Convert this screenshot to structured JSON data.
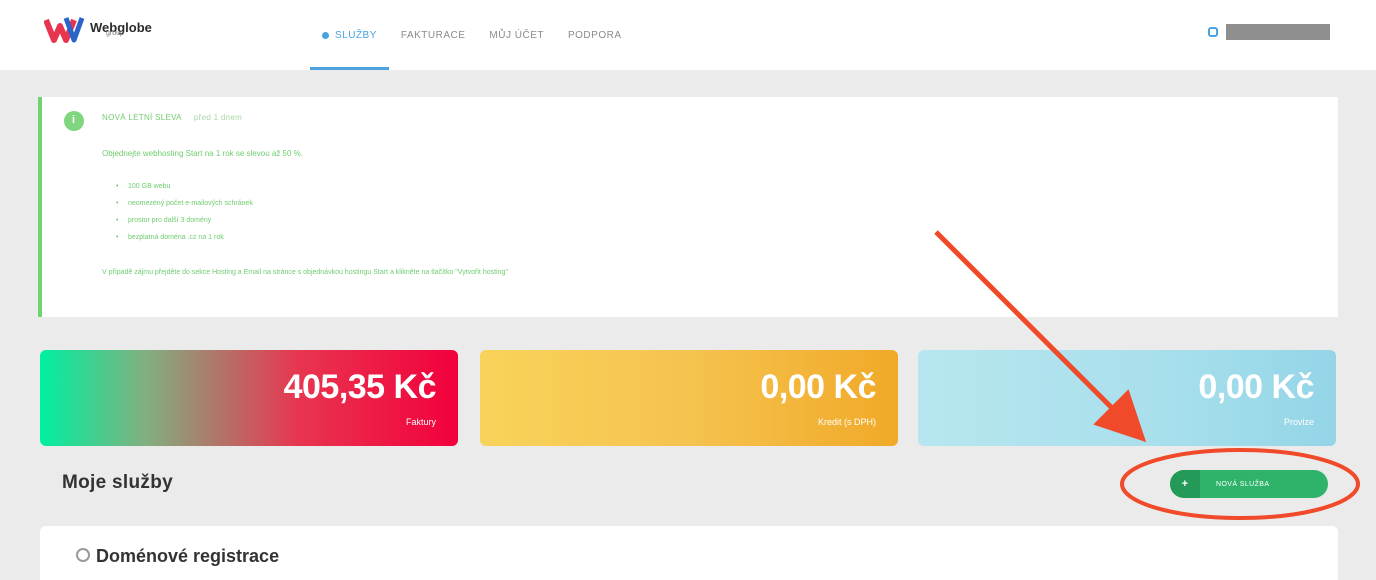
{
  "brand": {
    "name": "Webglobe",
    "sub": "group"
  },
  "nav": {
    "items": [
      {
        "label": "SLUŽBY",
        "active": true
      },
      {
        "label": "FAKTURACE",
        "active": false
      },
      {
        "label": "MŮJ ÚČET",
        "active": false
      },
      {
        "label": "PODPORA",
        "active": false
      }
    ]
  },
  "notice": {
    "title": "NOVÁ LETNÍ SLEVA",
    "date": "před 1 dnem",
    "lead": "Objednejte webhosting Start na 1 rok se slevou až 50 %.",
    "list": [
      "100 GB webu",
      "neomezený počet e-mailových schránek",
      "prostor pro další 3 domény",
      "bezplatná doména .cz na 1 rok"
    ],
    "footer": "V případě zájmu přejděte do sekce Hosting a Email na stránce s objednávkou hostingu Start a klikněte na tlačítko \"Vytvořit hosting\""
  },
  "summary": [
    {
      "value": "405,35 Kč",
      "label": "Faktury"
    },
    {
      "value": "0,00 Kč",
      "label": "Kredit (s DPH)"
    },
    {
      "value": "0,00 Kč",
      "label": "Provize"
    }
  ],
  "section_title": "Moje služby",
  "new_service_button": {
    "plus": "+",
    "label": "NOVÁ SLUŽBA"
  },
  "panel_title": "Doménové registrace",
  "colors": {
    "accent": "#4aa3df",
    "success": "#2fb36a",
    "annotation": "#f04a2a"
  },
  "icons": {
    "logo": "webglobe-logo-icon",
    "notice": "info-shield-icon",
    "panel": "globe-icon",
    "account": "user-icon"
  }
}
